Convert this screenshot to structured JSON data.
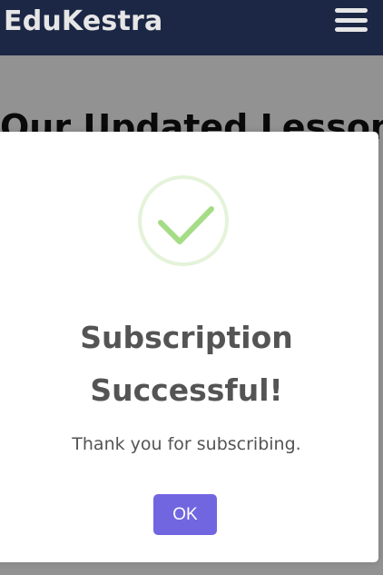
{
  "navbar": {
    "brand": "EduKestra",
    "menu_icon": "hamburger-menu-icon"
  },
  "background": {
    "heading": "Our Updated Lessons"
  },
  "modal": {
    "icon": "success-check-icon",
    "title_line1": "Subscription",
    "title_line2": "Successful!",
    "message": "Thank you for subscribing.",
    "ok_label": "OK"
  },
  "colors": {
    "navbar_bg": "#1b2744",
    "accent": "#7266e0",
    "success": "#a5dc86",
    "text": "#545454"
  }
}
